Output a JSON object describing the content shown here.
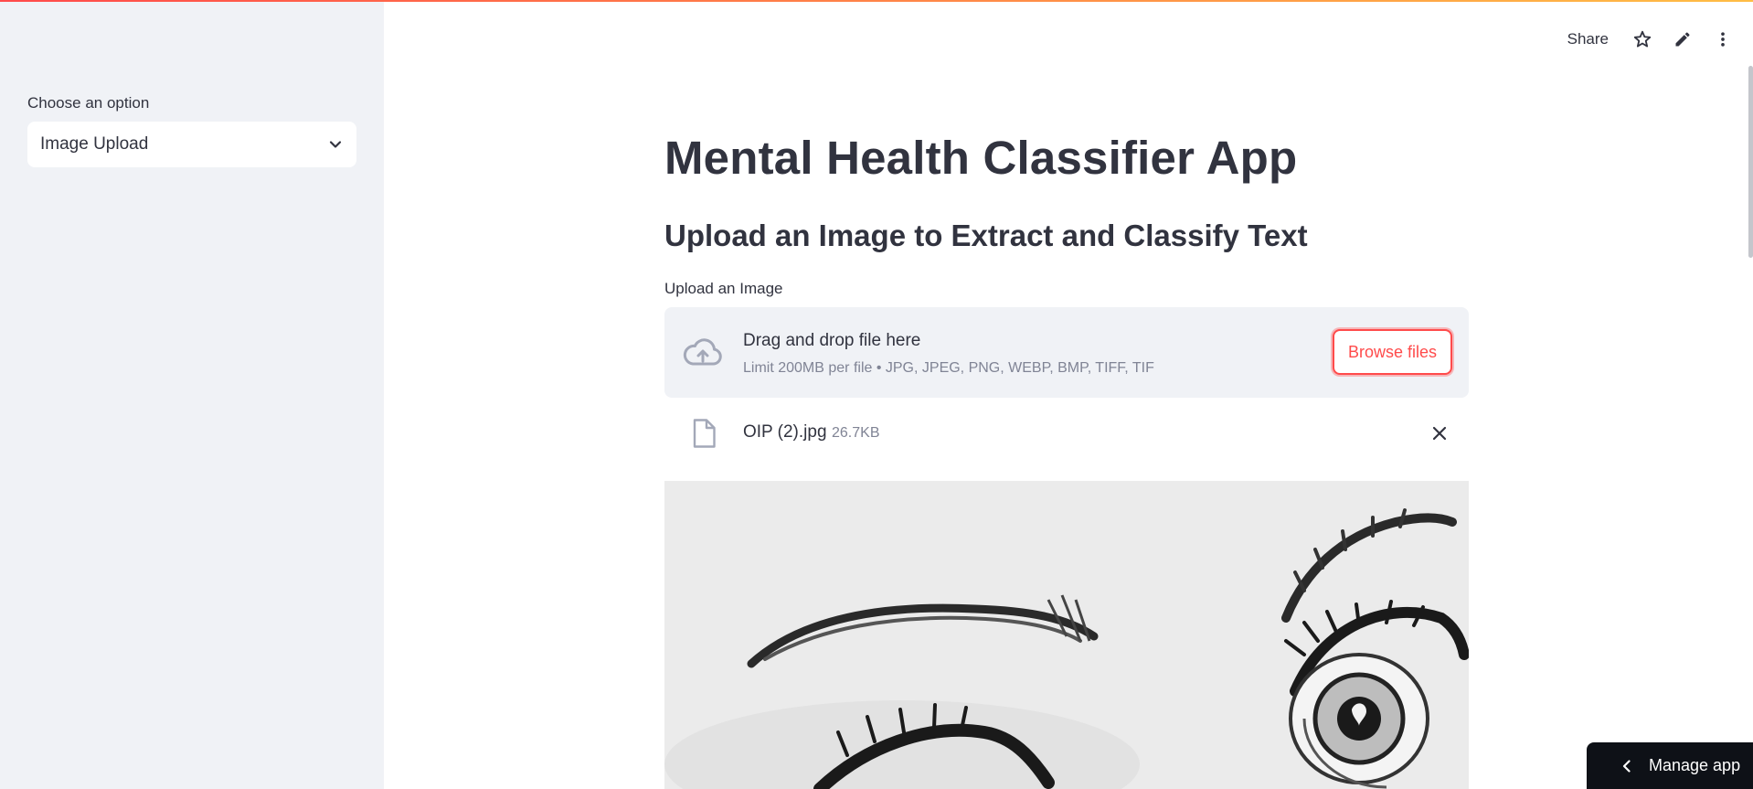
{
  "sidebar": {
    "select_label": "Choose an option",
    "select_value": "Image Upload"
  },
  "header": {
    "share_label": "Share",
    "icons": [
      "star-icon",
      "pencil-icon",
      "more-vertical-icon"
    ]
  },
  "main": {
    "title": "Mental Health Classifier App",
    "subheader": "Upload an Image to Extract and Classify Text",
    "uploader": {
      "label": "Upload an Image",
      "drop_text": "Drag and drop file here",
      "limit_text": "Limit 200MB per file • JPG, JPEG, PNG, WEBP, BMP, TIFF, TIF",
      "browse_label": "Browse files"
    },
    "uploaded_file": {
      "name": "OIP (2).jpg",
      "size": "26.7KB"
    }
  },
  "footer": {
    "manage_app_label": "Manage app"
  },
  "colors": {
    "accent": "#ff4b4b",
    "sidebar_bg": "#f0f2f6",
    "text": "#31333f",
    "muted": "#808495"
  }
}
